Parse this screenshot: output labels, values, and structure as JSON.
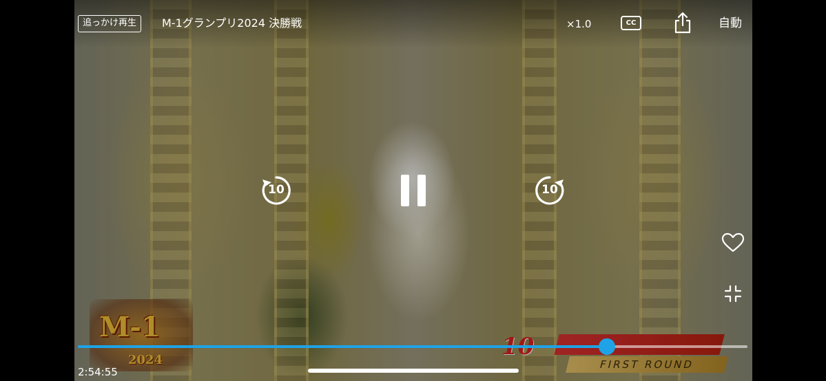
{
  "header": {
    "follow_label": "追っかけ再生",
    "title": "M-1グランプリ2024 決勝戦",
    "speed_label": "×1.0",
    "cc_label": "CC",
    "quality_label": "自動"
  },
  "controls": {
    "skip_back_label": "10",
    "skip_forward_label": "10"
  },
  "overlay": {
    "logo_text": "M-1",
    "logo_year": "2024",
    "score": "10",
    "round_label": "FIRST ROUND"
  },
  "player": {
    "elapsed_time": "2:54:55",
    "progress": 0.79,
    "accent_color": "#1ea3e6"
  },
  "icons": [
    "share-icon",
    "skip-back-10-icon",
    "pause-icon",
    "skip-forward-10-icon",
    "heart-icon",
    "exit-fullscreen-icon"
  ]
}
